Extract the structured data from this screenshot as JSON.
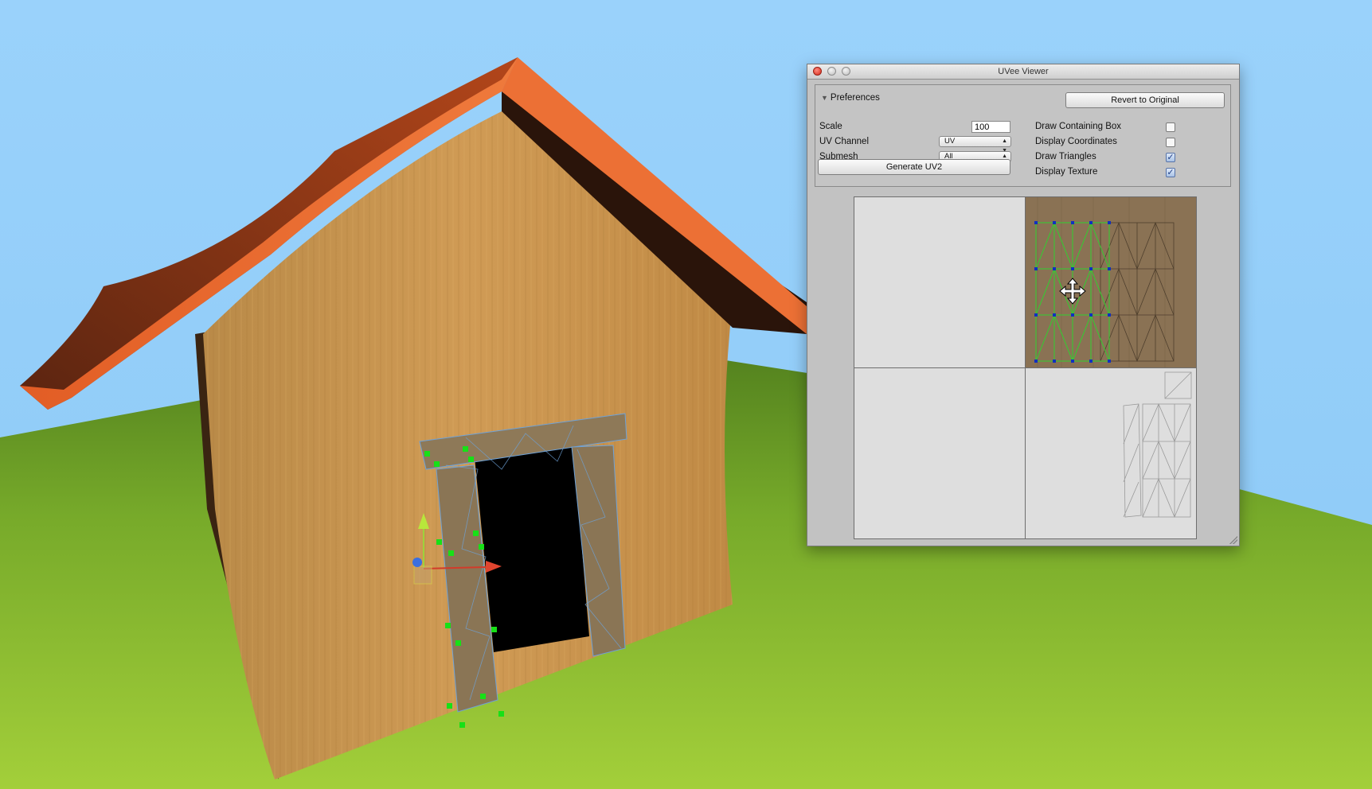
{
  "window": {
    "title": "UVee Viewer"
  },
  "preferences": {
    "foldout_label": "Preferences",
    "revert_button": "Revert to Original",
    "scale_label": "Scale",
    "scale_value": "100",
    "uv_channel_label": "UV Channel",
    "uv_channel_value": "UV",
    "submesh_label": "Submesh",
    "submesh_value": "All",
    "generate_uv2_button": "Generate UV2",
    "draw_containing_box_label": "Draw Containing Box",
    "draw_containing_box_checked": false,
    "display_coordinates_label": "Display Coordinates",
    "display_coordinates_checked": false,
    "draw_triangles_label": "Draw Triangles",
    "draw_triangles_checked": true,
    "display_texture_label": "Display Texture",
    "display_texture_checked": true
  },
  "colors": {
    "sky": "#98cff8",
    "grass": "#7fb22a",
    "roof": "#e86a2f",
    "wall": "#c9954f",
    "selection": "#17e017",
    "uv_selected_edges": "#30d030",
    "uv_vertex": "#1030c0"
  },
  "icons": {
    "foldout": "triangle-down-icon",
    "dropdown": "updown-arrows-icon",
    "checkmark": "checkmark-icon",
    "move_cursor": "move-cursor-icon"
  }
}
